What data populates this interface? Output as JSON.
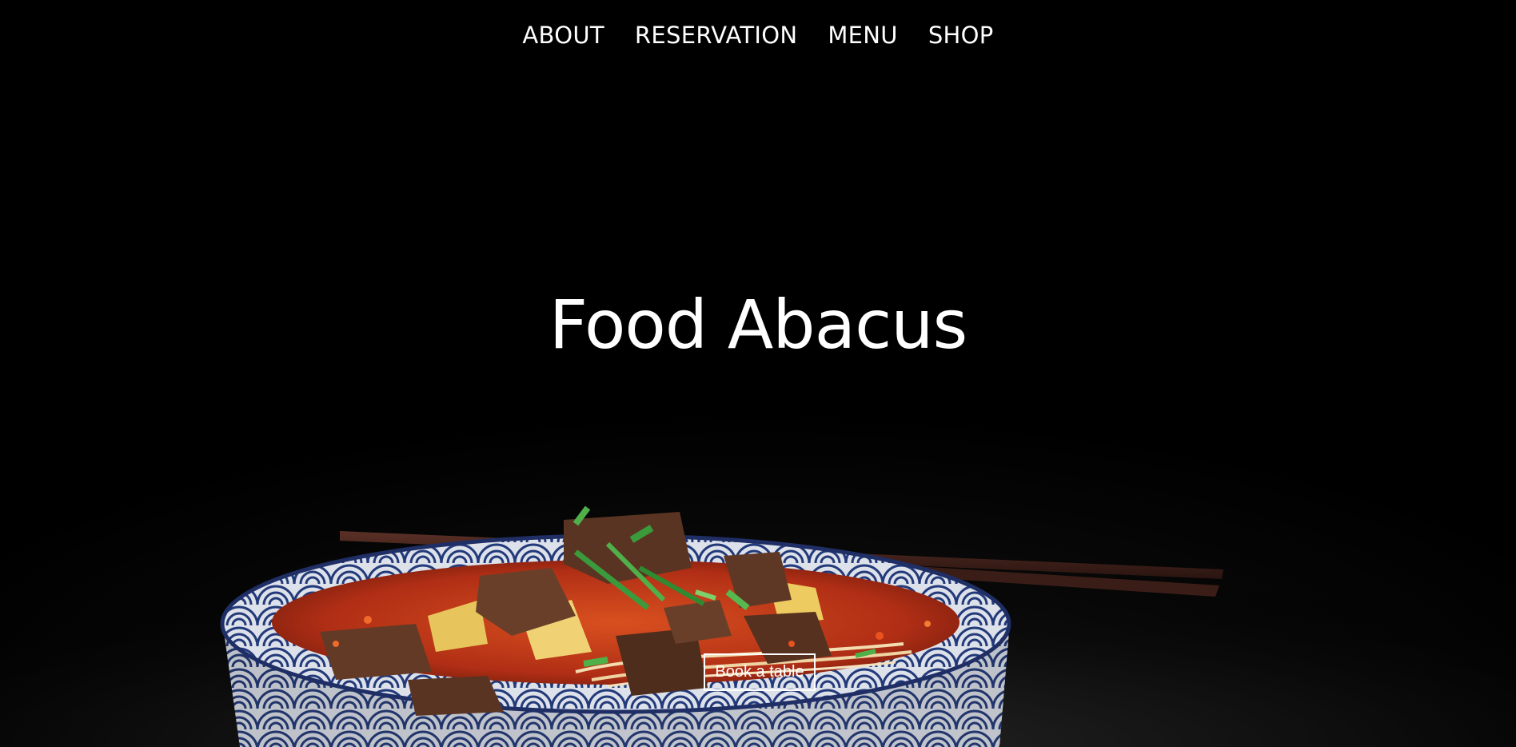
{
  "nav": {
    "items": [
      {
        "label": "ABOUT"
      },
      {
        "label": "RESERVATION"
      },
      {
        "label": "MENU"
      },
      {
        "label": "SHOP"
      }
    ]
  },
  "hero": {
    "title": "Food Abacus",
    "cta_label": "Book a table",
    "image": "noodle-soup-bowl-with-chopsticks"
  },
  "colors": {
    "background": "#000000",
    "text": "#ffffff",
    "bowl_blue": "#2b3f7a",
    "broth_red": "#c2361a"
  }
}
